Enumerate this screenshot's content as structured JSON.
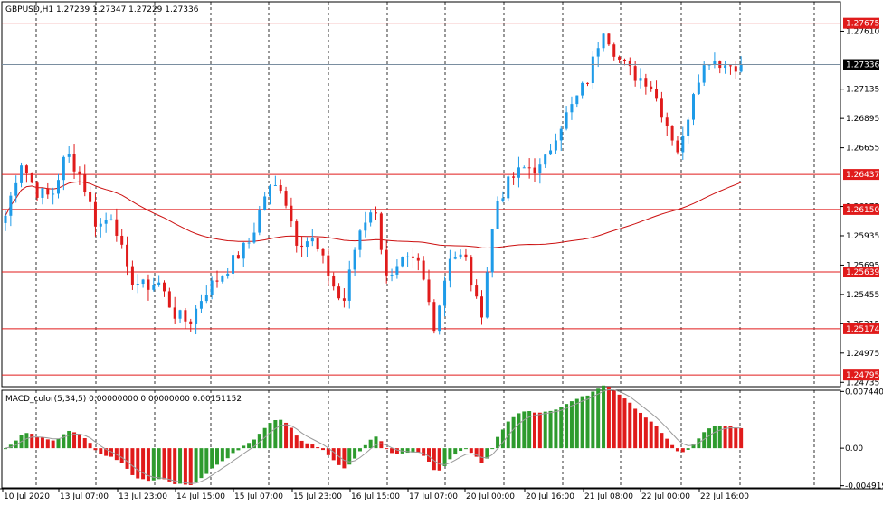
{
  "main_header": "GBPUSD,H1  1.27239  1.27347  1.27229  1.27336",
  "indicator_header": "MACD_color(5,34,5) 0.00000000 0.00000000 0.00151152",
  "price_scale": {
    "ticks": [
      {
        "label": "1.27610",
        "value": 1.2761
      },
      {
        "label": "1.27135",
        "value": 1.27135
      },
      {
        "label": "1.26895",
        "value": 1.26895
      },
      {
        "label": "1.26655",
        "value": 1.26655
      },
      {
        "label": "1.26175",
        "value": 1.26175
      },
      {
        "label": "1.25935",
        "value": 1.25935
      },
      {
        "label": "1.25695",
        "value": 1.25695
      },
      {
        "label": "1.25455",
        "value": 1.25455
      },
      {
        "label": "1.25215",
        "value": 1.25215
      },
      {
        "label": "1.24975",
        "value": 1.24975
      },
      {
        "label": "1.24735",
        "value": 1.24735
      }
    ],
    "last_price": {
      "label": "1.27336",
      "value": 1.27336
    },
    "range": [
      1.247,
      1.2785
    ]
  },
  "levels": [
    {
      "label": "1.27675",
      "value": 1.27675
    },
    {
      "label": "1.26437",
      "value": 1.26437
    },
    {
      "label": "1.26150",
      "value": 1.2615
    },
    {
      "label": "1.25639",
      "value": 1.25639
    },
    {
      "label": "1.25174",
      "value": 1.25174
    },
    {
      "label": "1.24795",
      "value": 1.24795
    }
  ],
  "macd_scale": {
    "ticks": [
      {
        "label": "0.0074402",
        "value": 0.0074402
      },
      {
        "label": "0.00",
        "value": 0.0
      },
      {
        "label": "-0.004919",
        "value": -0.004919
      }
    ],
    "range": [
      -0.0052,
      0.0076
    ]
  },
  "time_axis": [
    "10 Jul 2020",
    "13 Jul 07:00",
    "13 Jul 23:00",
    "14 Jul 15:00",
    "15 Jul 07:00",
    "15 Jul 23:00",
    "16 Jul 15:00",
    "17 Jul 07:00",
    "20 Jul 00:00",
    "20 Jul 16:00",
    "21 Jul 08:00",
    "22 Jul 00:00",
    "22 Jul 16:00"
  ],
  "colors": {
    "background": "#ffffff",
    "bull": "#1e9be8",
    "bear": "#e01b1b",
    "level_line": "#e01b1b",
    "moving_average": "#cc1010",
    "macd_up": "#2e9b2e",
    "macd_down": "#e01b1b",
    "grid": "#000000",
    "text": "#000000"
  },
  "chart_data": {
    "type": "candlestick",
    "symbol": "GBPUSD",
    "timeframe": "H1",
    "waypoints": [
      {
        "close": 1.261
      },
      {
        "close": 1.2655
      },
      {
        "close": 1.263
      },
      {
        "close": 1.2625
      },
      {
        "close": 1.2662
      },
      {
        "close": 1.264
      },
      {
        "close": 1.26
      },
      {
        "close": 1.2612
      },
      {
        "close": 1.256
      },
      {
        "close": 1.2552
      },
      {
        "close": 1.2555
      },
      {
        "close": 1.253
      },
      {
        "close": 1.2522
      },
      {
        "close": 1.2548
      },
      {
        "close": 1.256
      },
      {
        "close": 1.2575
      },
      {
        "close": 1.259
      },
      {
        "close": 1.263
      },
      {
        "close": 1.2635
      },
      {
        "close": 1.259
      },
      {
        "close": 1.259
      },
      {
        "close": 1.2565
      },
      {
        "close": 1.2535
      },
      {
        "close": 1.2595
      },
      {
        "close": 1.262
      },
      {
        "close": 1.2555
      },
      {
        "close": 1.2572
      },
      {
        "close": 1.257
      },
      {
        "close": 1.252
      },
      {
        "close": 1.2578
      },
      {
        "close": 1.2575
      },
      {
        "close": 1.2525
      },
      {
        "close": 1.262
      },
      {
        "close": 1.264
      },
      {
        "close": 1.265
      },
      {
        "close": 1.2648
      },
      {
        "close": 1.268
      },
      {
        "close": 1.27
      },
      {
        "close": 1.2722
      },
      {
        "close": 1.2765
      },
      {
        "close": 1.2738
      },
      {
        "close": 1.2725
      },
      {
        "close": 1.272
      },
      {
        "close": 1.269
      },
      {
        "close": 1.266
      },
      {
        "close": 1.272
      },
      {
        "close": 1.274
      },
      {
        "close": 1.2733
      },
      {
        "close": 1.2734
      }
    ]
  }
}
